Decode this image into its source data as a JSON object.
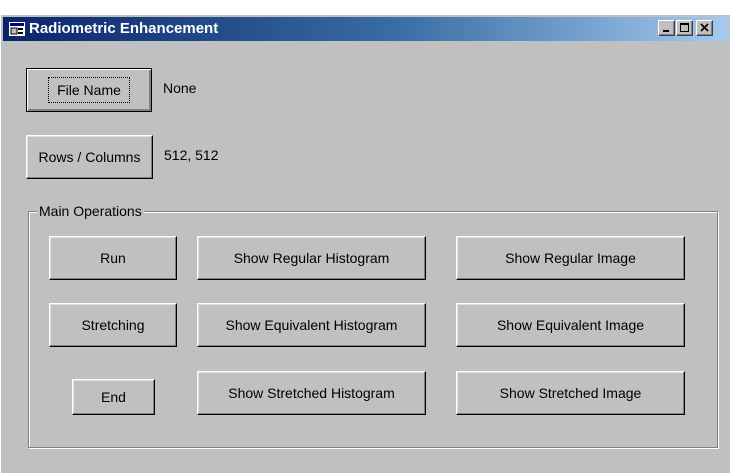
{
  "window": {
    "title": "Radiometric Enhancement",
    "controls": {
      "minimize_icon": "minimize-icon",
      "maximize_icon": "maximize-icon",
      "close_icon": "close-icon"
    }
  },
  "file": {
    "button_label": "File Name",
    "value": "None"
  },
  "size": {
    "button_label": "Rows / Columns",
    "value": "512, 512"
  },
  "main_operations": {
    "legend": "Main Operations",
    "run": "Run",
    "stretching": "Stretching",
    "end": "End",
    "show_regular_histogram": "Show Regular Histogram",
    "show_equivalent_histogram": "Show Equivalent Histogram",
    "show_stretched_histogram": "Show Stretched Histogram",
    "show_regular_image": "Show Regular Image",
    "show_equivalent_image": "Show Equivalent Image",
    "show_stretched_image": "Show Stretched Image"
  },
  "colors": {
    "face": "#c0c0c0",
    "title_start": "#0a246a",
    "title_end": "#a6caf0"
  }
}
